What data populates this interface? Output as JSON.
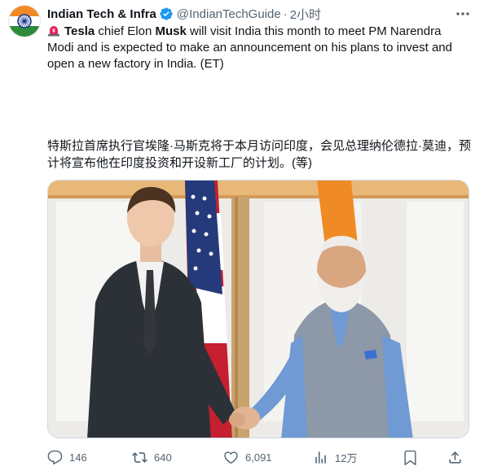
{
  "author": {
    "name": "Indian Tech & Infra",
    "handle": "@IndianTechGuide",
    "separator": "·",
    "time": "2小时",
    "verified_color": "#1d9bf0"
  },
  "tweet": {
    "bold_1": "Tesla",
    "text_1": " chief Elon ",
    "bold_2": "Musk",
    "text_2": " will visit India this month to meet PM Narendra Modi and is expected to make an announcement on his plans to invest and open a new factory in India. (ET)",
    "translation": "特斯拉首席执行官埃隆·马斯克将于本月访问印度，会见总理纳伦德拉·莫迪，预计将宣布他在印度投资和开设新工厂的计划。(等)"
  },
  "actions": {
    "replies": "146",
    "retweets": "640",
    "likes": "6,091",
    "views": "12万"
  },
  "colors": {
    "text": "#0f1419",
    "secondary": "#536471",
    "accent": "#1d9bf0",
    "siren": "#e0245e"
  },
  "icons": [
    "siren-icon",
    "verified-badge-icon",
    "more-icon",
    "reply-icon",
    "retweet-icon",
    "like-icon",
    "views-icon",
    "bookmark-icon",
    "share-icon"
  ]
}
